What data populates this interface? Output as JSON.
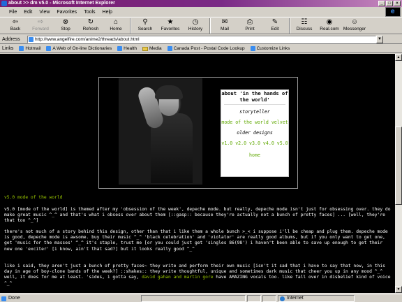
{
  "window": {
    "title": "about >> dm v5.0 - Microsoft Internet Explorer"
  },
  "menu": [
    "File",
    "Edit",
    "View",
    "Favorites",
    "Tools",
    "Help"
  ],
  "toolbar": [
    {
      "label": "Back",
      "icon": "back-arrow-icon",
      "glyph": "⇦",
      "enabled": true
    },
    {
      "label": "Forward",
      "icon": "forward-arrow-icon",
      "glyph": "⇨",
      "enabled": false
    },
    {
      "label": "Stop",
      "icon": "stop-icon",
      "glyph": "⊗",
      "enabled": true
    },
    {
      "label": "Refresh",
      "icon": "refresh-icon",
      "glyph": "↻",
      "enabled": true
    },
    {
      "label": "Home",
      "icon": "home-icon",
      "glyph": "⌂",
      "enabled": true
    },
    {
      "label": "Search",
      "icon": "search-icon",
      "glyph": "⚲",
      "enabled": true
    },
    {
      "label": "Favorites",
      "icon": "favorites-icon",
      "glyph": "★",
      "enabled": true
    },
    {
      "label": "History",
      "icon": "history-icon",
      "glyph": "◷",
      "enabled": true
    },
    {
      "label": "Mail",
      "icon": "mail-icon",
      "glyph": "✉",
      "enabled": true
    },
    {
      "label": "Print",
      "icon": "print-icon",
      "glyph": "⎙",
      "enabled": true
    },
    {
      "label": "Edit",
      "icon": "edit-icon",
      "glyph": "✎",
      "enabled": true
    },
    {
      "label": "Discuss",
      "icon": "discuss-icon",
      "glyph": "☷",
      "enabled": true
    },
    {
      "label": "Real.com",
      "icon": "realcom-icon",
      "glyph": "◉",
      "enabled": true
    },
    {
      "label": "Messenger",
      "icon": "messenger-icon",
      "glyph": "☺",
      "enabled": true
    }
  ],
  "address": {
    "label": "Address",
    "url": "http://www.angelfire.com/anime2/threads/about.html"
  },
  "links": {
    "label": "Links",
    "items": [
      {
        "label": "Hotmail",
        "kind": "page"
      },
      {
        "label": "A Web of On-line Dictionaries",
        "kind": "page"
      },
      {
        "label": "Health",
        "kind": "page"
      },
      {
        "label": "Media",
        "kind": "folder"
      },
      {
        "label": "Canada Post - Postal Code Lookup",
        "kind": "page"
      },
      {
        "label": "Customize Links",
        "kind": "page"
      }
    ]
  },
  "sidenav": {
    "title": "about 'in the hands of the world'",
    "storyteller": "storyteller",
    "mode": "mode of the world velvet",
    "older": "older designs",
    "versions": "v1.0 v2.0 v3.0 v4.0 v5.0",
    "home": "home"
  },
  "article": {
    "heading": "v5.0 mode of the world",
    "p1": "v5.0 [mode of the world] is themed after my 'obsession of the week', depeche mode. but really, depeche mode isn't just for obsessing over. they do make great music ^_^ and that's what i obsess over about them [::gasp:: because they're actually not a bunch of pretty faces] ... [well, they're that too ^_^]",
    "p2": "there's not much of a story behind this design, other than that i like them a whole bunch >_< i suppose i'll be cheap and plug them. depeche mode is good, depeche mode is awsome. buy their music ^_^ 'black celebration' and 'violator' are really good albums, but if you only want to get one, get 'music for the masses' ^_^ it's staple, trust me [or you could just get 'singles 86(98') i haven't been able to save up enough to get their new one 'exciter' [i know, ain't that sad?] but it looks really good ^_^",
    "p3_a": "like i said, they aren't just a bunch of pretty faces~ they write and perform their own music [isn't it sad that i have to say that now, in this day in age of boy-clone bands of the week?] ::shakes:: they write thoughtful, unique and sometimes dark music that cheer you up in any mood ^_^ well, it does for me at least. 'sides, i gotta say, ",
    "p3_hl": "david gahan and martin gore",
    "p3_b": " have AMAZING vocals too. like fall over in disbelief kind of voice ^_^"
  },
  "status": {
    "text": "Done",
    "zone": "Internet"
  }
}
